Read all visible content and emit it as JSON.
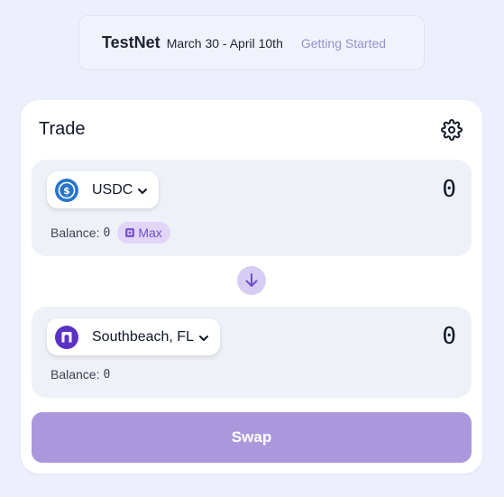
{
  "banner": {
    "title": "TestNet",
    "dates": "March 30 - April 10th",
    "link": "Getting Started"
  },
  "trade": {
    "title": "Trade",
    "from": {
      "token": "USDC",
      "token_icon": "usdc-icon",
      "amount": "0",
      "balance_label": "Balance:",
      "balance_value": "0",
      "max_label": "Max"
    },
    "to": {
      "token": "Southbeach, FL",
      "token_icon": "southbeach-token-icon",
      "amount": "0",
      "balance_label": "Balance:",
      "balance_value": "0"
    },
    "swap_label": "Swap"
  },
  "colors": {
    "background": "#edf0fc",
    "accent": "#ab98dc",
    "link": "#9a8fd0",
    "usdc": "#2775ca",
    "southbeach": "#5b33c4"
  }
}
